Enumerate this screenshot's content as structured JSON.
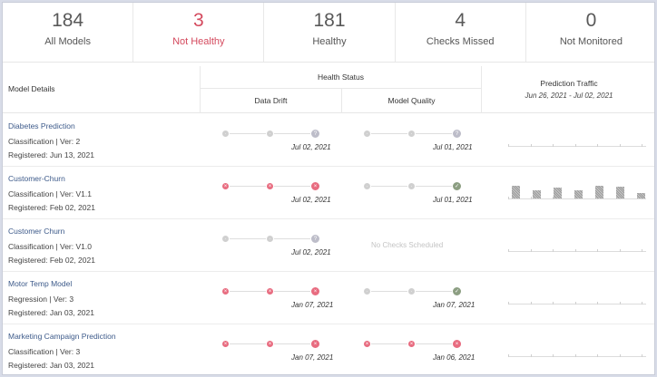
{
  "summary": [
    {
      "value": "184",
      "label": "All Models",
      "alert": false
    },
    {
      "value": "3",
      "label": "Not Healthy",
      "alert": true
    },
    {
      "value": "181",
      "label": "Healthy",
      "alert": false
    },
    {
      "value": "4",
      "label": "Checks Missed",
      "alert": false
    },
    {
      "value": "0",
      "label": "Not Monitored",
      "alert": false
    }
  ],
  "header": {
    "model_details": "Model Details",
    "health_status": "Health Status",
    "data_drift": "Data Drift",
    "model_quality": "Model Quality",
    "prediction_traffic": "Prediction Traffic",
    "traffic_range": "Jun 26, 2021 - Jul 02, 2021"
  },
  "colors": {
    "alert": "#d44a5e",
    "link": "#3d5a8a",
    "failed": "#e86c80",
    "passed": "#8c9e82",
    "unknown": "#bdbdc9",
    "neutral": "#d0d0d0"
  },
  "status_icons": {
    "failed": "x-icon",
    "passed": "check-icon",
    "unknown": "question-icon",
    "neutral": "dot-icon"
  },
  "models": [
    {
      "name": "Diabetes Prediction",
      "type": "Classification | Ver: 2",
      "registered": "Registered: Jun 13, 2021",
      "drift": {
        "statuses": [
          "grey",
          "grey",
          "unk"
        ],
        "date": "Jul 02, 2021"
      },
      "quality": {
        "statuses": [
          "grey",
          "grey",
          "unk"
        ],
        "date": "Jul 01, 2021"
      },
      "traffic": []
    },
    {
      "name": "Customer-Churn",
      "type": "Classification | Ver: V1.1",
      "registered": "Registered: Feb 02, 2021",
      "drift": {
        "statuses": [
          "red",
          "red",
          "red"
        ],
        "date": "Jul 02, 2021"
      },
      "quality": {
        "statuses": [
          "grey",
          "grey",
          "green"
        ],
        "date": "Jul 01, 2021"
      },
      "traffic": [
        0.7,
        0.45,
        0.6,
        0.45,
        0.7,
        0.65,
        0.3
      ]
    },
    {
      "name": "Customer Churn",
      "type": "Classification | Ver: V1.0",
      "registered": "Registered: Feb 02, 2021",
      "drift": {
        "statuses": [
          "grey",
          "grey",
          "unk"
        ],
        "date": "Jul 02, 2021"
      },
      "quality": {
        "no_checks": "No Checks Scheduled"
      },
      "traffic": []
    },
    {
      "name": "Motor Temp Model",
      "type": "Regression | Ver: 3",
      "registered": "Registered: Jan 03, 2021",
      "drift": {
        "statuses": [
          "red",
          "red",
          "red"
        ],
        "date": "Jan 07, 2021"
      },
      "quality": {
        "statuses": [
          "grey",
          "grey",
          "green"
        ],
        "date": "Jan 07, 2021"
      },
      "traffic": []
    },
    {
      "name": "Marketing Campaign Prediction",
      "type": "Classification | Ver: 3",
      "registered": "Registered: Jan 03, 2021",
      "drift": {
        "statuses": [
          "red",
          "red",
          "red"
        ],
        "date": "Jan 07, 2021"
      },
      "quality": {
        "statuses": [
          "red",
          "red",
          "red"
        ],
        "date": "Jan 06, 2021"
      },
      "traffic": []
    }
  ]
}
